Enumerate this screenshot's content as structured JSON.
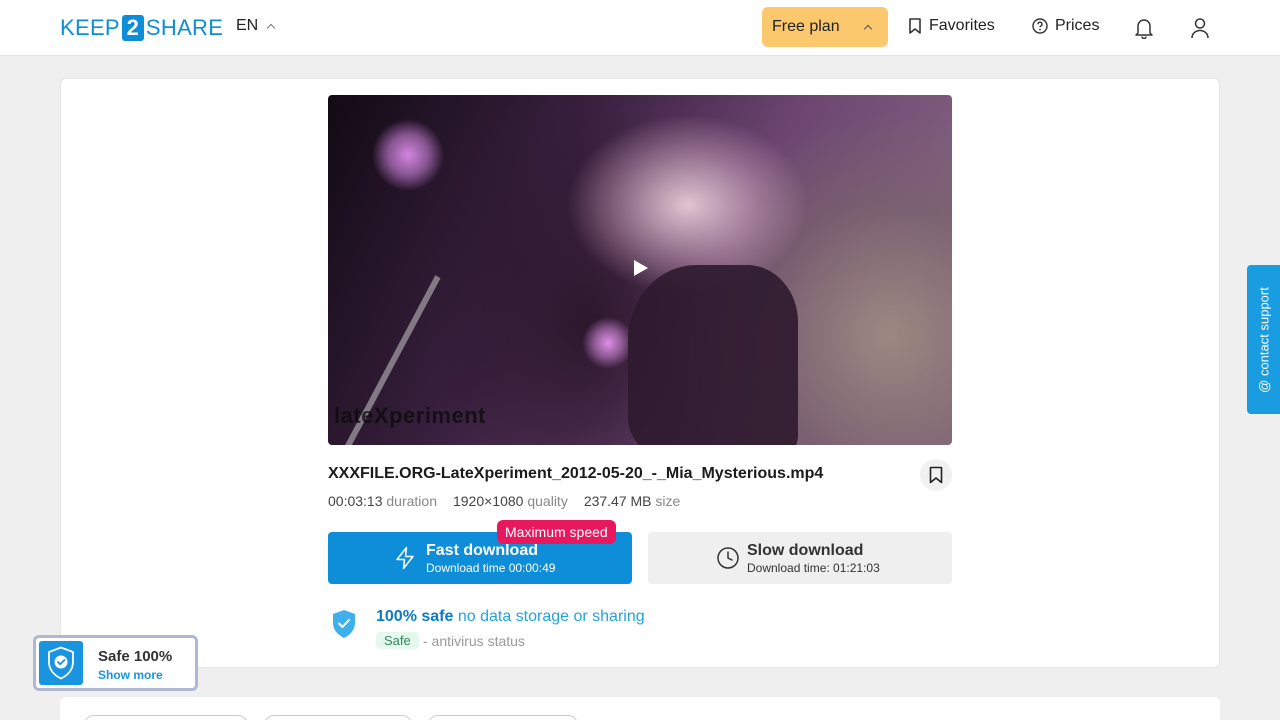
{
  "header": {
    "logo_left": "KEEP",
    "logo_mid": "2",
    "logo_right": "SHARE",
    "language": "EN",
    "plan_label": "Free plan",
    "favorites_label": "Favorites",
    "prices_label": "Prices"
  },
  "video": {
    "watermark": "lateXperiment"
  },
  "file": {
    "name": "XXXFILE.ORG-LateXperiment_2012-05-20_-_Mia_Mysterious.mp4",
    "duration_value": "00:03:13",
    "duration_label": "duration",
    "quality_value": "1920×1080",
    "quality_label": "quality",
    "size_value": "237.47 MB",
    "size_label": "size"
  },
  "downloads": {
    "badge": "Maximum speed",
    "fast_title": "Fast download",
    "fast_sub": "Download time 00:00:49",
    "slow_title": "Slow download",
    "slow_sub": "Download time: 01:21:03"
  },
  "safety": {
    "title_strong": "100% safe",
    "title_rest": "no data storage or sharing",
    "tag": "Safe",
    "status": "- antivirus status"
  },
  "support_label": "@ contact support",
  "safe_widget": {
    "title": "Safe 100%",
    "more": "Show more"
  },
  "colors": {
    "brand_blue": "#0e8ed8",
    "plan_yellow": "#fcc86e",
    "badge_pink": "#e8185f"
  }
}
